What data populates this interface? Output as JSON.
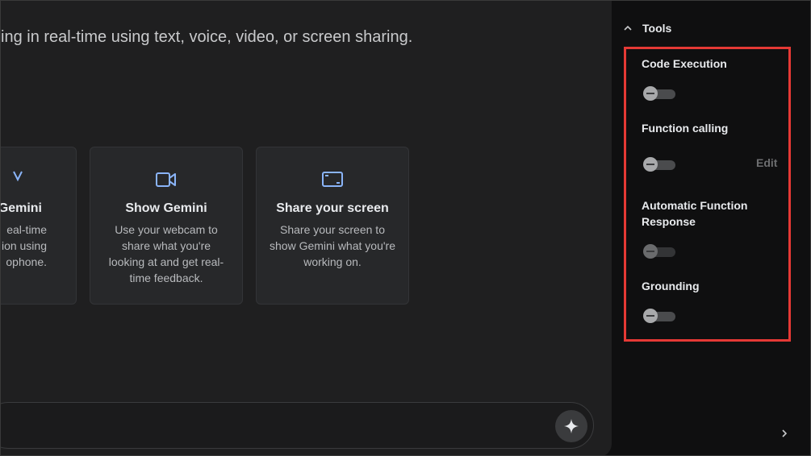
{
  "main": {
    "subtitle": "ing in real-time using text, voice, video, or screen sharing.",
    "cards": [
      {
        "title": "Gemini",
        "desc_lines": [
          "eal-time",
          "ion using",
          "ophone."
        ],
        "icon": "microphone-icon"
      },
      {
        "title": "Show Gemini",
        "desc": "Use your webcam to share what you're looking at and get real-time feedback.",
        "icon": "video-camera-icon"
      },
      {
        "title": "Share your screen",
        "desc": "Share your screen to show Gemini what you're working on.",
        "icon": "screen-share-icon"
      }
    ],
    "send_icon": "sparkle-icon"
  },
  "sidebar": {
    "tools_label": "Tools",
    "tools": [
      {
        "label": "Code Execution",
        "enabled": false
      },
      {
        "label": "Function calling",
        "enabled": false,
        "action": "Edit"
      },
      {
        "label": "Automatic Function Response",
        "enabled": false,
        "disabled": true
      },
      {
        "label": "Grounding",
        "enabled": false
      }
    ],
    "highlight_color": "#e53935"
  }
}
